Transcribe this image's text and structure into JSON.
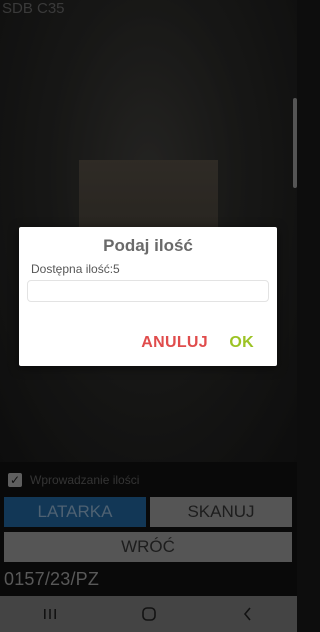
{
  "app": {
    "top_label": "SDB C35"
  },
  "dialog": {
    "title": "Podaj ilość",
    "label": "Dostępna ilość:5",
    "input_value": "",
    "cancel_label": "ANULUJ",
    "ok_label": "OK",
    "colors": {
      "cancel": "#e04c4c",
      "ok": "#9cc324"
    }
  },
  "panel": {
    "checkbox": {
      "label": "Wprowadzanie ilości",
      "checked": true
    },
    "buttons": {
      "latarka": "LATARKA",
      "skanuj": "SKANUJ",
      "wroc": "WRÓĆ"
    },
    "document_number": "0157/23/PZ"
  },
  "navbar": {
    "icons": [
      "recent-apps-icon",
      "home-icon",
      "back-icon"
    ]
  }
}
